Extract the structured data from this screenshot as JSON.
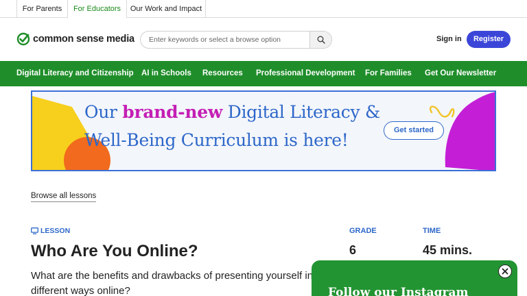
{
  "audience_tabs": [
    {
      "label": "For Parents"
    },
    {
      "label": "For Educators"
    },
    {
      "label": "Our Work and Impact"
    }
  ],
  "header": {
    "logo_text": "common sense media",
    "search_placeholder": "Enter keywords or select a browse option",
    "signin_label": "Sign in",
    "register_label": "Register"
  },
  "nav": {
    "items": [
      {
        "label": "Digital Literacy and Citizenship"
      },
      {
        "label": "AI in Schools"
      },
      {
        "label": "Resources"
      },
      {
        "label": "Professional Development"
      },
      {
        "label": "For Families"
      },
      {
        "label": "Get Our Newsletter"
      }
    ]
  },
  "banner": {
    "line1_pre": "Our ",
    "line1_em": "brand-new",
    "line1_post": " Digital Literacy &",
    "line2": "Well-Being Curriculum is here!",
    "cta_label": "Get started"
  },
  "browse_link": "Browse all lessons",
  "lesson": {
    "tag": "LESSON",
    "title": "Who Are You Online?",
    "description": "What are the benefits and drawbacks of presenting yourself in different ways online?",
    "grade_label": "GRADE",
    "grade_value": "6",
    "time_label": "TIME",
    "time_value": "45 mins."
  },
  "popup": {
    "title": "Follow our Instagram"
  },
  "colors": {
    "brand_green": "#1f8e2a",
    "register_blue": "#3b46d8",
    "banner_blue": "#2d67c9",
    "banner_magenta": "#c41fb4"
  }
}
